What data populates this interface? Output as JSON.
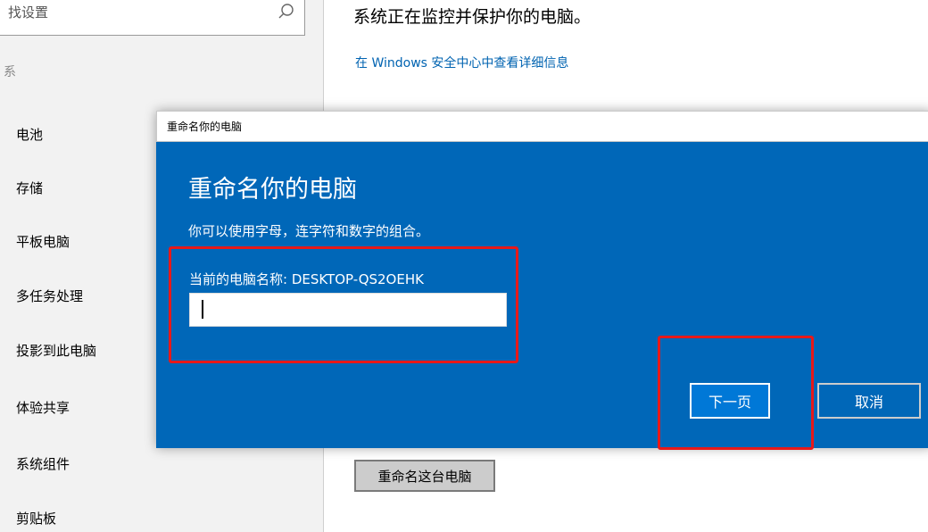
{
  "sidebar": {
    "search_placeholder": "找设置",
    "section_fragment": "系",
    "items": [
      {
        "label": "电池"
      },
      {
        "label": "存储"
      },
      {
        "label": "平板电脑"
      },
      {
        "label": "多任务处理"
      },
      {
        "label": "投影到此电脑"
      },
      {
        "label": "体验共享"
      },
      {
        "label": "系统组件"
      },
      {
        "label": "剪贴板"
      }
    ]
  },
  "main": {
    "title": "系统正在监控并保护你的电脑。",
    "security_link": "在 Windows 安全中心中查看详细信息",
    "rename_button": "重命名这台电脑"
  },
  "dialog": {
    "window_title": "重命名你的电脑",
    "heading": "重命名你的电脑",
    "description": "你可以使用字母，连字符和数字的组合。",
    "current_name": "当前的电脑名称: DESKTOP-QS2OEHK",
    "input_value": "",
    "next_button": "下一页",
    "cancel_button": "取消"
  },
  "colors": {
    "dialog_bg": "#0067b8",
    "highlight": "#e81919",
    "link": "#0063b1"
  },
  "icons": {
    "search": "search-icon"
  }
}
